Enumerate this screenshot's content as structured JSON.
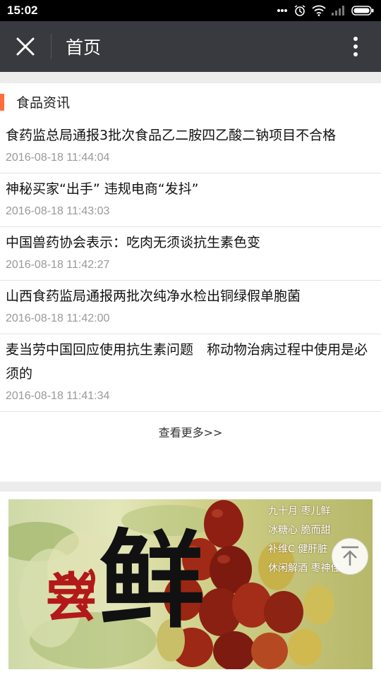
{
  "status": {
    "time": "15:02"
  },
  "appbar": {
    "title": "首页"
  },
  "section": {
    "title": "食品资讯"
  },
  "news": [
    {
      "title": "食药监总局通报3批次食品乙二胺四乙酸二钠项目不合格",
      "time": "2016-08-18 11:44:04"
    },
    {
      "title": "神秘买家“出手” 违规电商“发抖”",
      "time": "2016-08-18 11:43:03"
    },
    {
      "title": "中国兽药协会表示：吃肉无须谈抗生素色变",
      "time": "2016-08-18 11:42:27"
    },
    {
      "title": "山西食药监局通报两批次纯净水检出铜绿假单胞菌",
      "time": "2016-08-18 11:42:00"
    },
    {
      "title": "麦当劳中国回应使用抗生素问题　称动物治病过程中使用是必须的",
      "time": "2016-08-18 11:41:34"
    }
  ],
  "more_link": "查看更多>>",
  "banner": {
    "title_char1": "尝",
    "title_char2": "鲜",
    "lines": [
      "九十月 枣儿鲜",
      "冰糖心 脆而甜",
      "补维C 健肝脏",
      "休闲解酒 枣神佳"
    ]
  },
  "colors": {
    "accent": "#ff6d3a",
    "appbar": "#393a3f"
  },
  "icons": {
    "close": "close-icon",
    "more": "more-vertical-icon",
    "scroll_top": "arrow-up-to-top-icon"
  }
}
